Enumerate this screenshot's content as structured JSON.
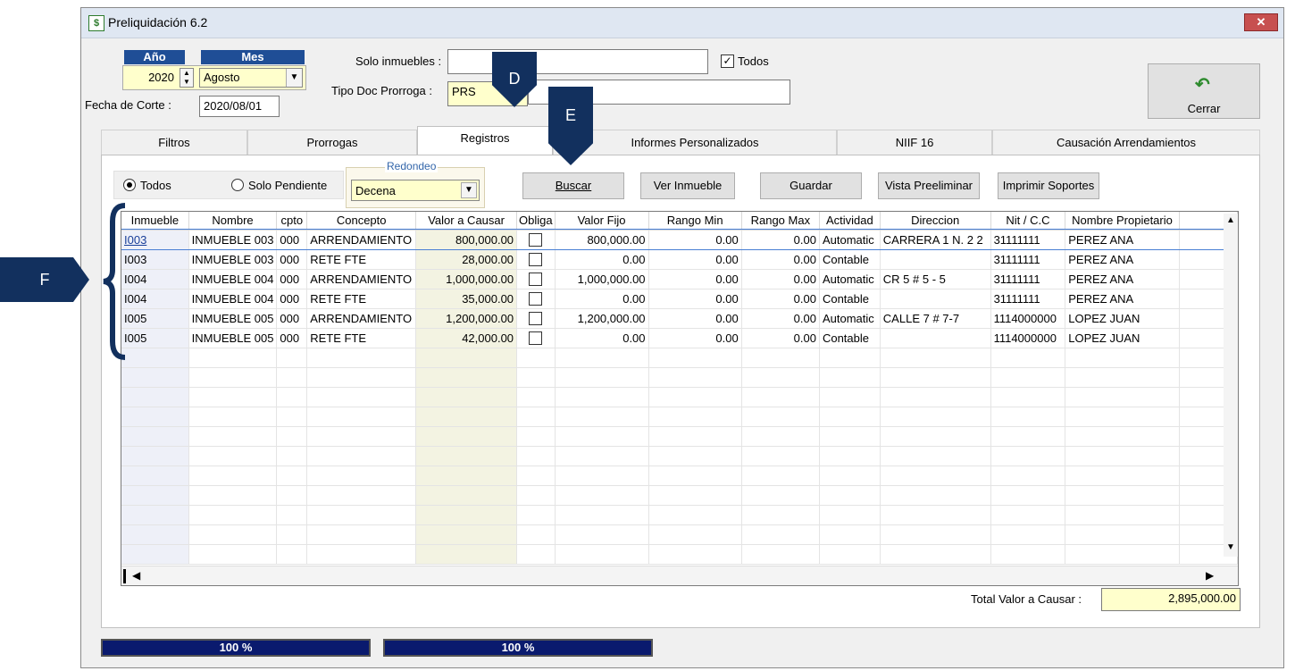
{
  "window": {
    "title": "Preliquidación 6.2",
    "close_label": "✕"
  },
  "period": {
    "year_header": "Año",
    "month_header": "Mes",
    "year": "2020",
    "month": "Agosto"
  },
  "cut_date": {
    "label": "Fecha de Corte :",
    "value": "2020/08/01"
  },
  "filters": {
    "solo_inmuebles_label": "Solo inmuebles :",
    "solo_inmuebles_value": "",
    "todos_label": "Todos",
    "tipo_doc_label": "Tipo Doc Prorroga :",
    "tipo_doc_value": "PRS"
  },
  "close_button": {
    "label": "Cerrar"
  },
  "tabs": [
    {
      "label": "Filtros"
    },
    {
      "label": "Prorrogas"
    },
    {
      "label": "Registros"
    },
    {
      "label": "Informes Personalizados"
    },
    {
      "label": "NIIF 16"
    },
    {
      "label": "Causación Arrendamientos"
    }
  ],
  "options": {
    "todos_radio": "Todos",
    "pendiente_radio": "Solo Pendiente",
    "redondeo_label": "Redondeo",
    "redondeo_value": "Decena"
  },
  "actions": {
    "buscar": "Buscar",
    "ver_inmueble": "Ver Inmueble",
    "guardar": "Guardar",
    "vista": "Vista Preeliminar",
    "imprimir": "Imprimir Soportes"
  },
  "grid": {
    "columns": [
      "Inmueble",
      "Nombre",
      "cpto",
      "Concepto",
      "Valor a Causar",
      "Obliga",
      "Valor Fijo",
      "Rango Min",
      "Rango Max",
      "Actividad",
      "Direccion",
      "Nit / C.C",
      "Nombre Propietario"
    ],
    "rows": [
      [
        "I003",
        "INMUEBLE 003",
        "000",
        "ARRENDAMIENTO",
        "800,000.00",
        "",
        "800,000.00",
        "0.00",
        "0.00",
        "Automatic",
        "CARRERA 1 N. 2 2",
        "31111111",
        "PEREZ ANA"
      ],
      [
        "I003",
        "INMUEBLE 003",
        "000",
        "RETE FTE",
        "28,000.00",
        "",
        "0.00",
        "0.00",
        "0.00",
        "Contable",
        "",
        "31111111",
        "PEREZ ANA"
      ],
      [
        "I004",
        "INMUEBLE 004",
        "000",
        "ARRENDAMIENTO",
        "1,000,000.00",
        "",
        "1,000,000.00",
        "0.00",
        "0.00",
        "Automatic",
        "CR 5  # 5 - 5",
        "31111111",
        "PEREZ ANA"
      ],
      [
        "I004",
        "INMUEBLE 004",
        "000",
        "RETE FTE",
        "35,000.00",
        "",
        "0.00",
        "0.00",
        "0.00",
        "Contable",
        "",
        "31111111",
        "PEREZ ANA"
      ],
      [
        "I005",
        "INMUEBLE 005",
        "000",
        "ARRENDAMIENTO",
        "1,200,000.00",
        "",
        "1,200,000.00",
        "0.00",
        "0.00",
        "Automatic",
        "CALLE 7 # 7-7",
        "1114000000",
        "LOPEZ JUAN"
      ],
      [
        "I005",
        "INMUEBLE 005",
        "000",
        "RETE FTE",
        "42,000.00",
        "",
        "0.00",
        "0.00",
        "0.00",
        "Contable",
        "",
        "1114000000",
        "LOPEZ JUAN"
      ]
    ]
  },
  "total": {
    "label": "Total Valor a Causar :",
    "value": "2,895,000.00"
  },
  "progress": [
    {
      "label": "100 %",
      "fraction": 1.0
    },
    {
      "label": "100 %",
      "fraction": 1.0
    }
  ],
  "markers": {
    "d": "D",
    "e": "E",
    "f": "F"
  },
  "colors": {
    "header_blue": "#1f4e96",
    "marker_navy": "#12305e",
    "progress_navy": "#0a1a6e",
    "input_yellow": "#ffffcc"
  }
}
